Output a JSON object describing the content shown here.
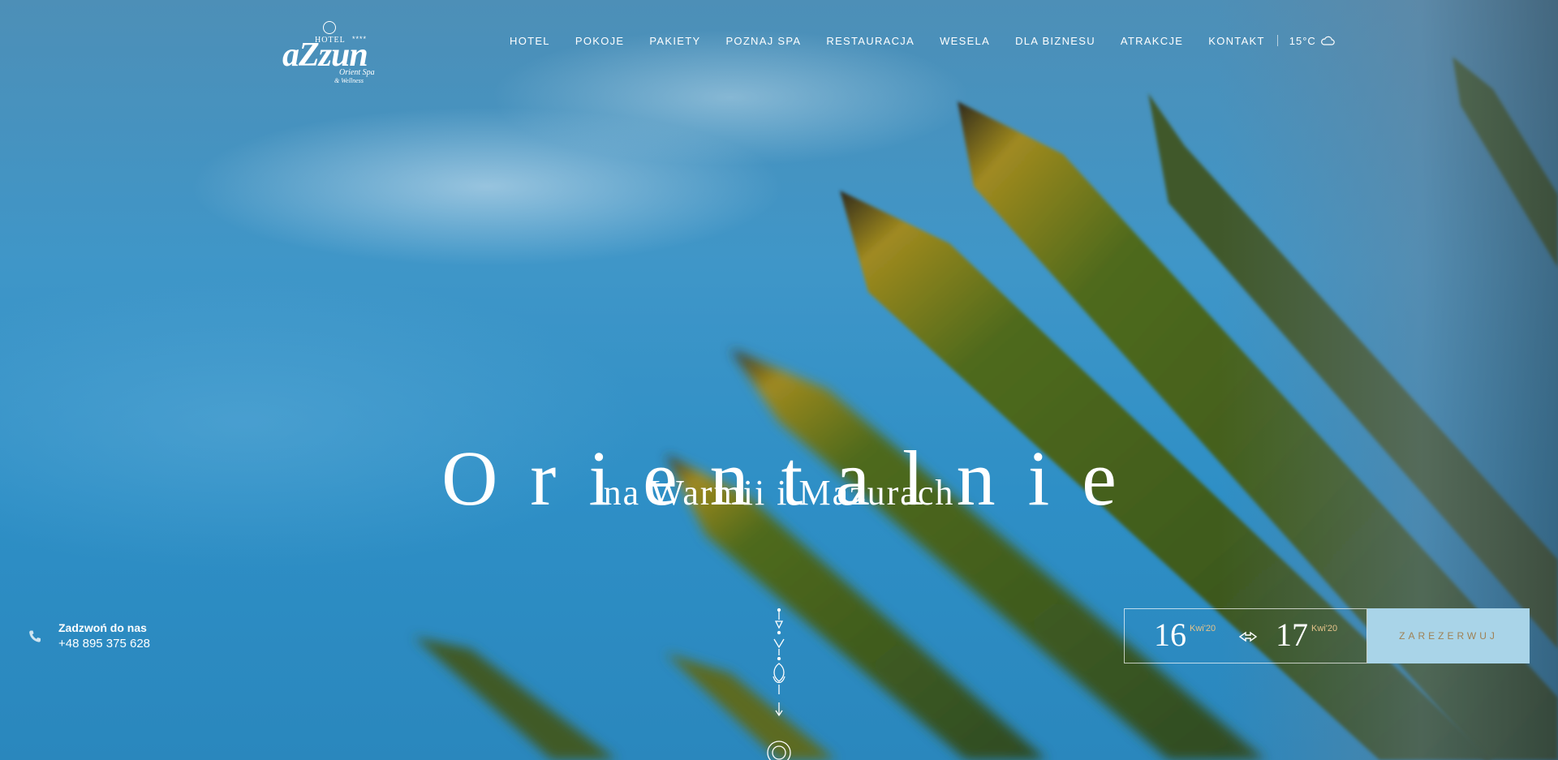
{
  "logo": {
    "hotel": "HOTEL",
    "stars": "****",
    "name": "aZzun",
    "sub1": "Orient Spa",
    "sub2": "& Wellness"
  },
  "nav": {
    "items": [
      "HOTEL",
      "POKOJE",
      "PAKIETY",
      "POZNAJ SPA",
      "RESTAURACJA",
      "WESELA",
      "DLA BIZNESU",
      "ATRAKCJE",
      "KONTAKT"
    ],
    "weather_temp": "15°C",
    "weather_icon": "cloud-icon"
  },
  "hero": {
    "headline": "Orientalnie",
    "subline": "na Warmii i Mazurach"
  },
  "contact": {
    "label": "Zadzwoń do nas",
    "phone": "+48 895 375 628",
    "icon": "phone-icon"
  },
  "booking": {
    "from_day": "16",
    "from_month": "Kwi'20",
    "to_day": "17",
    "to_month": "Kwi'20",
    "button": "ZAREZERWUJ"
  },
  "colors": {
    "button_bg": "#a9d4e8",
    "button_text": "#a08154",
    "month_accent": "#e5c38a"
  }
}
